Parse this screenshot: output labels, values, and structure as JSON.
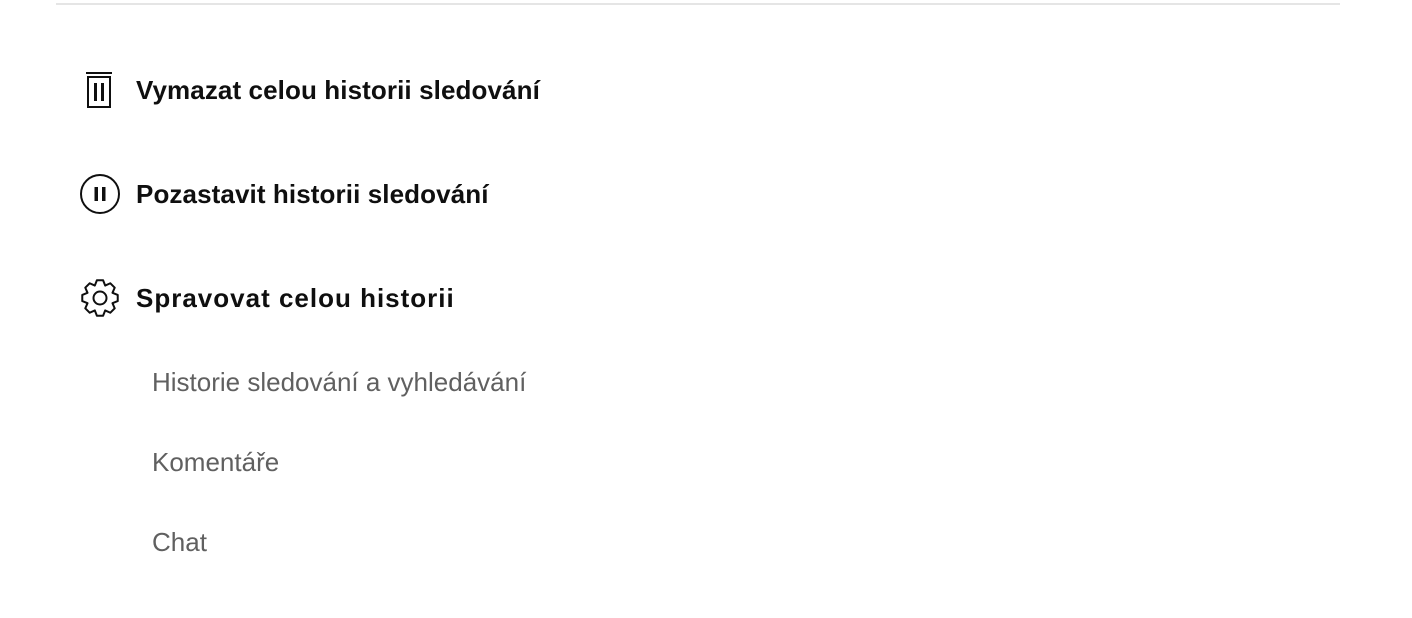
{
  "actions": [
    {
      "icon": "trash-icon",
      "label": "Vymazat celou historii sledování"
    },
    {
      "icon": "pause-circle-icon",
      "label": "Pozastavit historii sledování"
    },
    {
      "icon": "gear-icon",
      "label": "Spravovat celou historii"
    }
  ],
  "manage_links": [
    {
      "label": "Historie sledování a vyhledávání"
    },
    {
      "label": "Komentáře"
    },
    {
      "label": "Chat"
    }
  ],
  "colors": {
    "primary_text": "#0f0f0f",
    "secondary_text": "#606060",
    "divider": "#e5e5e5",
    "background": "#ffffff"
  }
}
